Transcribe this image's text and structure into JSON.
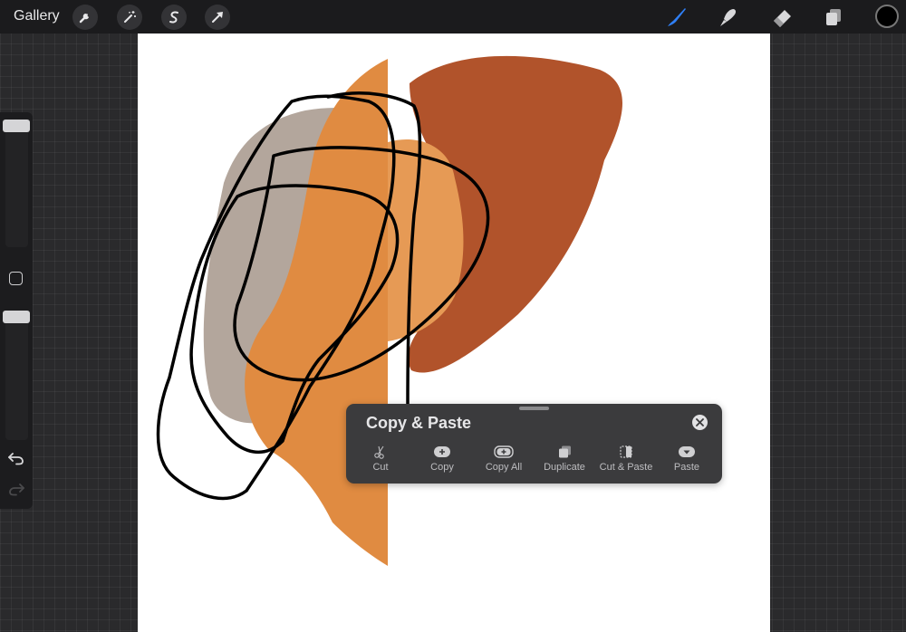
{
  "topbar": {
    "gallery_label": "Gallery",
    "left_tools": [
      {
        "name": "actions",
        "icon": "wrench-icon"
      },
      {
        "name": "adjustments",
        "icon": "magic-wand-icon"
      },
      {
        "name": "selection",
        "icon": "selection-s-icon"
      },
      {
        "name": "transform",
        "icon": "arrow-cursor-icon"
      }
    ],
    "right_tools": [
      {
        "name": "brush",
        "icon": "brush-icon",
        "active": true
      },
      {
        "name": "smudge",
        "icon": "smudge-icon"
      },
      {
        "name": "eraser",
        "icon": "eraser-icon"
      },
      {
        "name": "layers",
        "icon": "layers-icon"
      }
    ],
    "current_color": "#000000",
    "active_color": "#2f7ff5"
  },
  "sidebar": {
    "brush_size_level": 0.95,
    "opacity_level": 0.95,
    "modifier_icon": "square-icon",
    "undo_icon": "undo-icon",
    "redo_icon": "redo-icon"
  },
  "canvas": {
    "colors": {
      "taupe": "#b3a69c",
      "orange": "#e08b41",
      "light_orange": "#e69a55",
      "rust": "#b1532b",
      "stroke": "#000000"
    }
  },
  "panel": {
    "title": "Copy & Paste",
    "close_icon": "close-icon",
    "actions": [
      {
        "label": "Cut",
        "icon": "scissors-icon"
      },
      {
        "label": "Copy",
        "icon": "plus-pill-icon"
      },
      {
        "label": "Copy All",
        "icon": "plus-square-icon"
      },
      {
        "label": "Duplicate",
        "icon": "duplicate-icon"
      },
      {
        "label": "Cut & Paste",
        "icon": "cut-paste-icon"
      },
      {
        "label": "Paste",
        "icon": "paste-down-icon"
      }
    ]
  }
}
